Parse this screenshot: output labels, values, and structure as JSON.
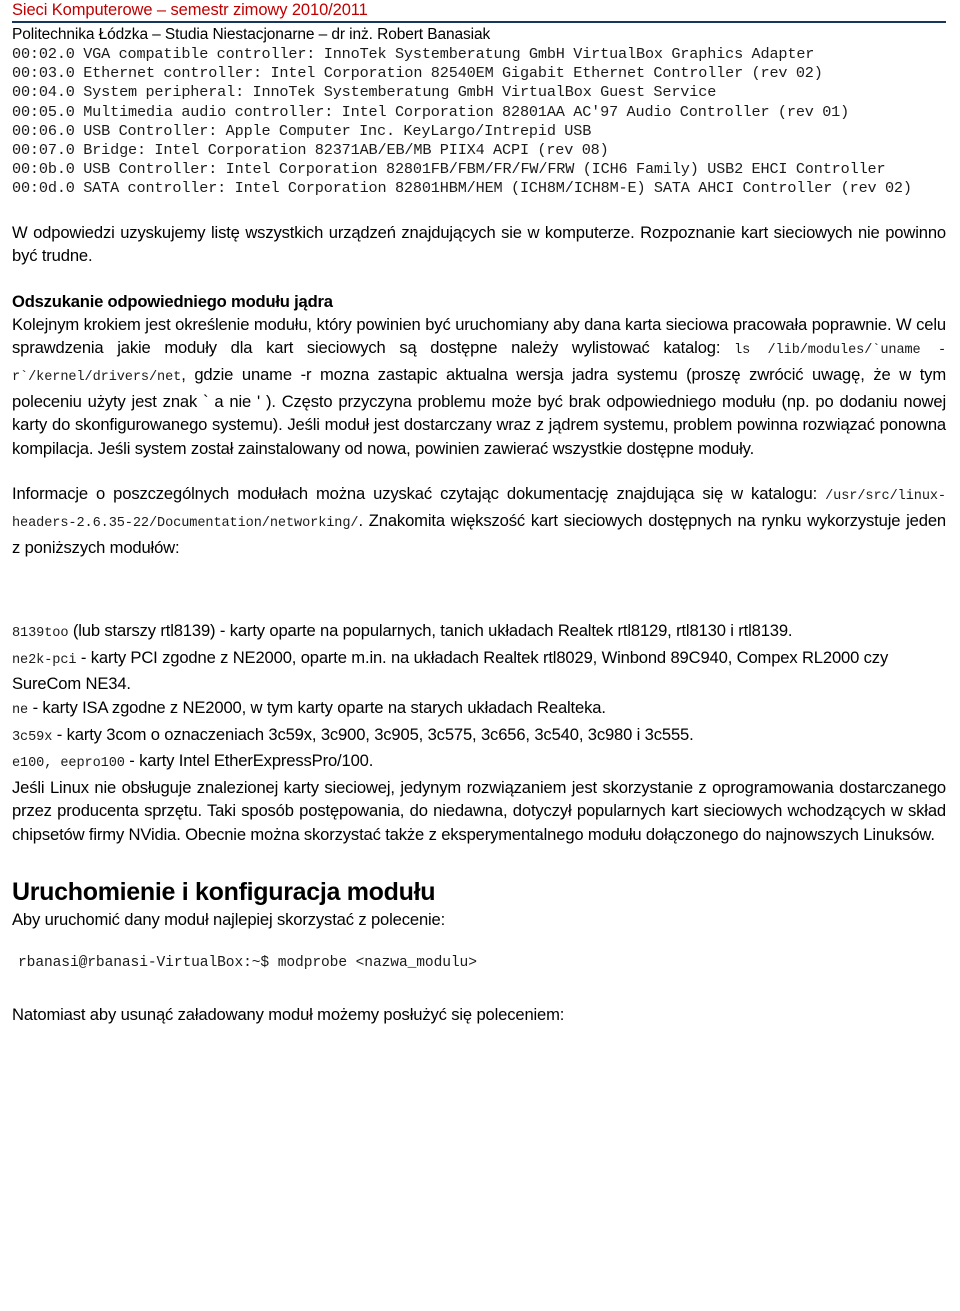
{
  "header": {
    "course_title": "Sieci Komputerowe – semestr zimowy 2010/2011",
    "affiliation": "Politechnika Łódzka – Studia Niestacjonarne – dr inż. Robert Banasiak",
    "rule_color": "#17365D",
    "title_color": "#C00000"
  },
  "lspci_output": {
    "lines": [
      "00:02.0 VGA compatible controller: InnoTek Systemberatung GmbH VirtualBox Graphics Adapter",
      "00:03.0 Ethernet controller: Intel Corporation 82540EM Gigabit Ethernet Controller (rev 02)",
      "00:04.0 System peripheral: InnoTek Systemberatung GmbH VirtualBox Guest Service",
      "00:05.0 Multimedia audio controller: Intel Corporation 82801AA AC'97 Audio Controller (rev 01)",
      "00:06.0 USB Controller: Apple Computer Inc. KeyLargo/Intrepid USB",
      "00:07.0 Bridge: Intel Corporation 82371AB/EB/MB PIIX4 ACPI (rev 08)",
      "00:0b.0 USB Controller: Intel Corporation 82801FB/FBM/FR/FW/FRW (ICH6 Family) USB2 EHCI Controller",
      "00:0d.0 SATA controller: Intel Corporation 82801HBM/HEM (ICH8M/ICH8M-E) SATA AHCI Controller (rev 02)"
    ]
  },
  "body": {
    "intro_paragraph": "W odpowiedzi uzyskujemy listę wszystkich urządzeń znajdujących sie w komputerze. Rozpoznanie kart sieciowych nie powinno być trudne.",
    "subheading_module": "Odszukanie odpowiedniego modułu jądra",
    "module_p1_part1": "Kolejnym krokiem jest określenie modułu, który powinien być uruchomiany aby dana karta sieciowa pracowała poprawnie. W celu sprawdzenia jakie moduły dla kart sieciowych są dostępne należy wylistować katalog: ",
    "module_p1_code": "ls /lib/modules/`uname -r`/kernel/drivers/net",
    "module_p1_part2": ", gdzie uname -r mozna zastapic aktualna wersja jadra systemu (proszę zwrócić uwagę, że w tym poleceniu użyty jest znak ` a nie ' ). Często przyczyna problemu może być brak odpowiedniego modułu (np. po dodaniu nowej karty do skonfigurowanego systemu). Jeśli moduł jest dostarczany wraz z jądrem systemu, problem powinna rozwiązać ponowna kompilacja. Jeśli system został zainstalowany od nowa, powinien zawierać wszystkie dostępne moduły.",
    "docs_p_part1": "Informacje o poszczególnych modułach można uzyskać czytając dokumentację znajdująca się w katalogu: ",
    "docs_p_code": "/usr/src/linux-headers-2.6.35-22/Documentation/networking/",
    "docs_p_part2": ". Znakomita większość kart sieciowych dostępnych na rynku wykorzystuje jeden z poniższych modułów:"
  },
  "modules": [
    {
      "code": "8139too",
      "description": " (lub starszy rtl8139) - karty oparte na popularnych, tanich układach Realtek rtl8129, rtl8130 i rtl8139."
    },
    {
      "code": "ne2k-pci",
      "description": " - karty PCI zgodne z NE2000, oparte m.in. na układach Realtek rtl8029, Winbond 89C940, Compex RL2000 czy SureCom NE34."
    },
    {
      "code": "ne",
      "description": " - karty ISA zgodne z NE2000, w tym karty oparte na starych układach Realteka."
    },
    {
      "code": "3c59x",
      "description": " - karty 3com o oznaczeniach 3c59x, 3c900, 3c905, 3c575, 3c656, 3c540, 3c980 i 3c555."
    },
    {
      "code": "e100, eepro100",
      "description": " - karty Intel EtherExpressPro/100."
    }
  ],
  "closing": {
    "paragraph": "Jeśli Linux nie obsługuje znalezionej karty sieciowej, jedynym rozwiązaniem jest skorzystanie z oprogramowania dostarczanego przez producenta sprzętu. Taki sposób postępowania, do niedawna, dotyczył popularnych kart sieciowych wchodzących w skład chipsetów firmy NVidia. Obecnie można skorzystać także z eksperymentalnego modułu dołączonego do najnowszych Linuksów."
  },
  "section": {
    "heading": "Uruchomienie i konfiguracja modułu",
    "lead": "Aby uruchomić dany moduł najlepiej skorzystać z polecenie:",
    "terminal_command": "rbanasi@rbanasi-VirtualBox:~$  modprobe <nazwa_modulu>",
    "trailer": "Natomiast aby usunąć załadowany moduł możemy posłużyć się poleceniem:"
  }
}
